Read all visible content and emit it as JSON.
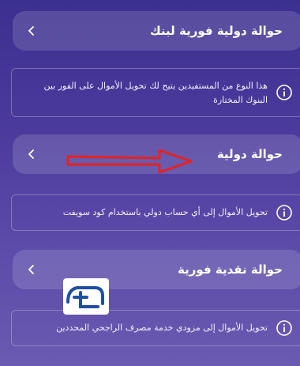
{
  "sections": [
    {
      "title": "حوالة دولية فورية لبنك",
      "info": [
        "هذا النوع من المستفيدين يتيح لك تحويل الأموال على الفور بين",
        "البنوك المختارة"
      ]
    },
    {
      "title": "حوالة دولية",
      "info": [
        "تحويل الأموال إلى أي حساب دولي باستخدام كود سويفت"
      ]
    },
    {
      "title": "حوالة نقدية فورية",
      "info": [
        "تحويل الأموال إلى مزودي خدمة مصرف الراجحي المحددين"
      ]
    }
  ],
  "icons": {
    "chevron": "chevron-left-icon",
    "info": "info-icon",
    "arrow": "red-arrow-annotation",
    "logo": "watermark-logo"
  },
  "colors": {
    "accent_arrow": "#e52222",
    "logo_blue": "#1f4fa0"
  }
}
